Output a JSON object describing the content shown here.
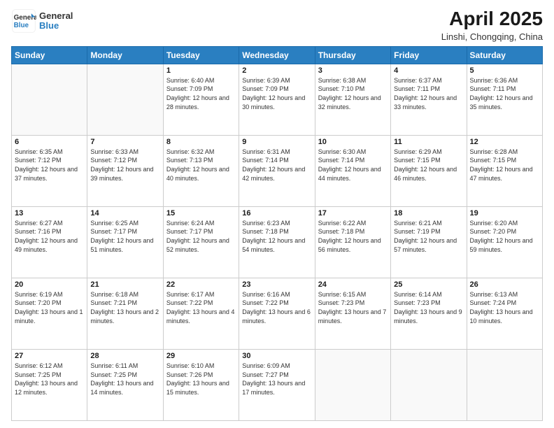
{
  "header": {
    "logo_general": "General",
    "logo_blue": "Blue",
    "main_title": "April 2025",
    "subtitle": "Linshi, Chongqing, China"
  },
  "weekdays": [
    "Sunday",
    "Monday",
    "Tuesday",
    "Wednesday",
    "Thursday",
    "Friday",
    "Saturday"
  ],
  "weeks": [
    [
      {
        "day": "",
        "sunrise": "",
        "sunset": "",
        "daylight": ""
      },
      {
        "day": "",
        "sunrise": "",
        "sunset": "",
        "daylight": ""
      },
      {
        "day": "1",
        "sunrise": "Sunrise: 6:40 AM",
        "sunset": "Sunset: 7:09 PM",
        "daylight": "Daylight: 12 hours and 28 minutes."
      },
      {
        "day": "2",
        "sunrise": "Sunrise: 6:39 AM",
        "sunset": "Sunset: 7:09 PM",
        "daylight": "Daylight: 12 hours and 30 minutes."
      },
      {
        "day": "3",
        "sunrise": "Sunrise: 6:38 AM",
        "sunset": "Sunset: 7:10 PM",
        "daylight": "Daylight: 12 hours and 32 minutes."
      },
      {
        "day": "4",
        "sunrise": "Sunrise: 6:37 AM",
        "sunset": "Sunset: 7:11 PM",
        "daylight": "Daylight: 12 hours and 33 minutes."
      },
      {
        "day": "5",
        "sunrise": "Sunrise: 6:36 AM",
        "sunset": "Sunset: 7:11 PM",
        "daylight": "Daylight: 12 hours and 35 minutes."
      }
    ],
    [
      {
        "day": "6",
        "sunrise": "Sunrise: 6:35 AM",
        "sunset": "Sunset: 7:12 PM",
        "daylight": "Daylight: 12 hours and 37 minutes."
      },
      {
        "day": "7",
        "sunrise": "Sunrise: 6:33 AM",
        "sunset": "Sunset: 7:12 PM",
        "daylight": "Daylight: 12 hours and 39 minutes."
      },
      {
        "day": "8",
        "sunrise": "Sunrise: 6:32 AM",
        "sunset": "Sunset: 7:13 PM",
        "daylight": "Daylight: 12 hours and 40 minutes."
      },
      {
        "day": "9",
        "sunrise": "Sunrise: 6:31 AM",
        "sunset": "Sunset: 7:14 PM",
        "daylight": "Daylight: 12 hours and 42 minutes."
      },
      {
        "day": "10",
        "sunrise": "Sunrise: 6:30 AM",
        "sunset": "Sunset: 7:14 PM",
        "daylight": "Daylight: 12 hours and 44 minutes."
      },
      {
        "day": "11",
        "sunrise": "Sunrise: 6:29 AM",
        "sunset": "Sunset: 7:15 PM",
        "daylight": "Daylight: 12 hours and 46 minutes."
      },
      {
        "day": "12",
        "sunrise": "Sunrise: 6:28 AM",
        "sunset": "Sunset: 7:15 PM",
        "daylight": "Daylight: 12 hours and 47 minutes."
      }
    ],
    [
      {
        "day": "13",
        "sunrise": "Sunrise: 6:27 AM",
        "sunset": "Sunset: 7:16 PM",
        "daylight": "Daylight: 12 hours and 49 minutes."
      },
      {
        "day": "14",
        "sunrise": "Sunrise: 6:25 AM",
        "sunset": "Sunset: 7:17 PM",
        "daylight": "Daylight: 12 hours and 51 minutes."
      },
      {
        "day": "15",
        "sunrise": "Sunrise: 6:24 AM",
        "sunset": "Sunset: 7:17 PM",
        "daylight": "Daylight: 12 hours and 52 minutes."
      },
      {
        "day": "16",
        "sunrise": "Sunrise: 6:23 AM",
        "sunset": "Sunset: 7:18 PM",
        "daylight": "Daylight: 12 hours and 54 minutes."
      },
      {
        "day": "17",
        "sunrise": "Sunrise: 6:22 AM",
        "sunset": "Sunset: 7:18 PM",
        "daylight": "Daylight: 12 hours and 56 minutes."
      },
      {
        "day": "18",
        "sunrise": "Sunrise: 6:21 AM",
        "sunset": "Sunset: 7:19 PM",
        "daylight": "Daylight: 12 hours and 57 minutes."
      },
      {
        "day": "19",
        "sunrise": "Sunrise: 6:20 AM",
        "sunset": "Sunset: 7:20 PM",
        "daylight": "Daylight: 12 hours and 59 minutes."
      }
    ],
    [
      {
        "day": "20",
        "sunrise": "Sunrise: 6:19 AM",
        "sunset": "Sunset: 7:20 PM",
        "daylight": "Daylight: 13 hours and 1 minute."
      },
      {
        "day": "21",
        "sunrise": "Sunrise: 6:18 AM",
        "sunset": "Sunset: 7:21 PM",
        "daylight": "Daylight: 13 hours and 2 minutes."
      },
      {
        "day": "22",
        "sunrise": "Sunrise: 6:17 AM",
        "sunset": "Sunset: 7:22 PM",
        "daylight": "Daylight: 13 hours and 4 minutes."
      },
      {
        "day": "23",
        "sunrise": "Sunrise: 6:16 AM",
        "sunset": "Sunset: 7:22 PM",
        "daylight": "Daylight: 13 hours and 6 minutes."
      },
      {
        "day": "24",
        "sunrise": "Sunrise: 6:15 AM",
        "sunset": "Sunset: 7:23 PM",
        "daylight": "Daylight: 13 hours and 7 minutes."
      },
      {
        "day": "25",
        "sunrise": "Sunrise: 6:14 AM",
        "sunset": "Sunset: 7:23 PM",
        "daylight": "Daylight: 13 hours and 9 minutes."
      },
      {
        "day": "26",
        "sunrise": "Sunrise: 6:13 AM",
        "sunset": "Sunset: 7:24 PM",
        "daylight": "Daylight: 13 hours and 10 minutes."
      }
    ],
    [
      {
        "day": "27",
        "sunrise": "Sunrise: 6:12 AM",
        "sunset": "Sunset: 7:25 PM",
        "daylight": "Daylight: 13 hours and 12 minutes."
      },
      {
        "day": "28",
        "sunrise": "Sunrise: 6:11 AM",
        "sunset": "Sunset: 7:25 PM",
        "daylight": "Daylight: 13 hours and 14 minutes."
      },
      {
        "day": "29",
        "sunrise": "Sunrise: 6:10 AM",
        "sunset": "Sunset: 7:26 PM",
        "daylight": "Daylight: 13 hours and 15 minutes."
      },
      {
        "day": "30",
        "sunrise": "Sunrise: 6:09 AM",
        "sunset": "Sunset: 7:27 PM",
        "daylight": "Daylight: 13 hours and 17 minutes."
      },
      {
        "day": "",
        "sunrise": "",
        "sunset": "",
        "daylight": ""
      },
      {
        "day": "",
        "sunrise": "",
        "sunset": "",
        "daylight": ""
      },
      {
        "day": "",
        "sunrise": "",
        "sunset": "",
        "daylight": ""
      }
    ]
  ]
}
